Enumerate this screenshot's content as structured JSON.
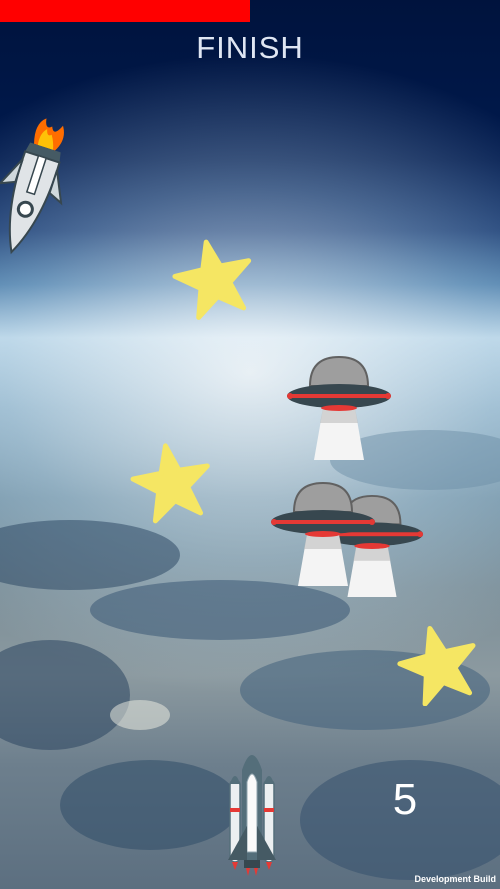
{
  "hud": {
    "progress_fraction": 0.5,
    "progress_color": "#ff0000",
    "finish_label": "FINISH",
    "score": "5",
    "dev_label": "Development Build"
  },
  "sprites": {
    "player": "space-shuttle-icon",
    "enemy_rocket": "burning-rocket-icon",
    "ufo": "ufo-icon",
    "star": "star-icon"
  },
  "colors": {
    "star": "#f5e663",
    "ufo_body": "#37474f",
    "ufo_stripe": "#e53935"
  }
}
